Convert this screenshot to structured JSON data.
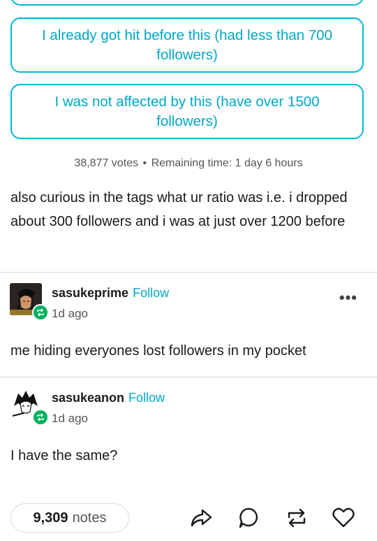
{
  "poll": {
    "option1": "I already got hit before this (had less than 700 followers)",
    "option2": "I was not affected by this (have over 1500 followers)",
    "votes": "38,877 votes",
    "separator": "•",
    "remaining": "Remaining time: 1 day 6 hours"
  },
  "post_text": "also curious in the tags what ur ratio was i.e. i dropped about 300 followers and i was at just over 1200 before",
  "replies": [
    {
      "username": "sasukeprime",
      "follow": "Follow",
      "time": "1d ago",
      "text": "me hiding everyones lost followers in my pocket"
    },
    {
      "username": "sasukeanon",
      "follow": "Follow",
      "time": "1d ago",
      "text": "I have the same?"
    }
  ],
  "footer": {
    "notes_count": "9,309",
    "notes_label": "notes"
  },
  "more_menu": "•••",
  "icons": [
    "share-icon",
    "reply-icon",
    "reblog-icon",
    "like-icon",
    "more-icon",
    "reblog-badge-icon"
  ],
  "colors": {
    "accent": "#00b8d9",
    "badge": "#00b060"
  }
}
